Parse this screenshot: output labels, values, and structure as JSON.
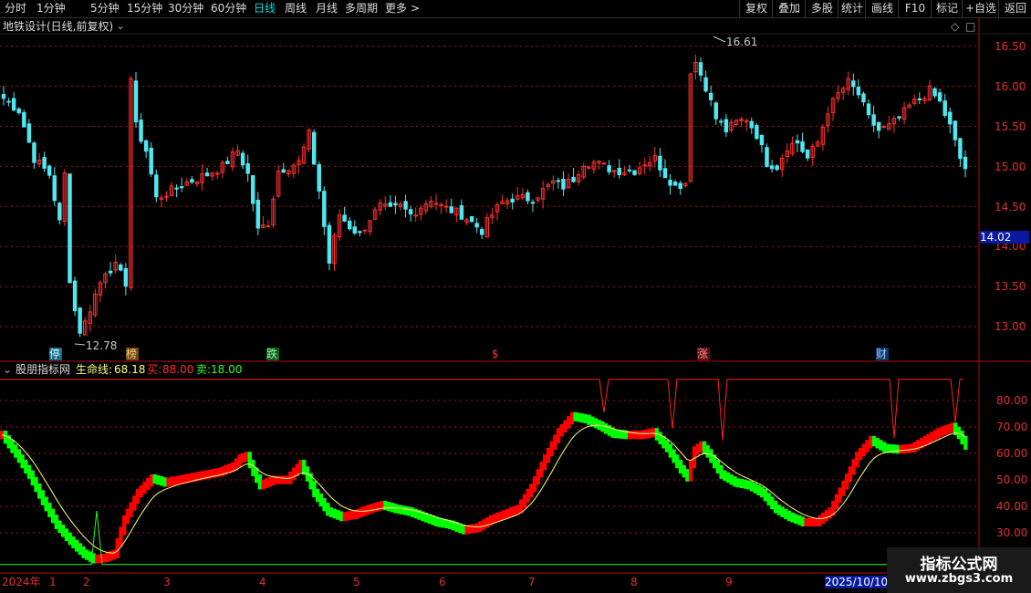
{
  "toolbar": {
    "periods": [
      "分时",
      "1分钟",
      "5分钟",
      "15分钟",
      "30分钟",
      "60分钟",
      "日线",
      "周线",
      "月线",
      "多周期",
      "更多"
    ],
    "selected_period": "日线",
    "right_buttons": [
      "复权",
      "叠加",
      "多股",
      "统计",
      "画线",
      "F10",
      "标记",
      "+自选",
      "返回"
    ]
  },
  "main_panel": {
    "title": "地铁设计(日线,前复权)",
    "price_ticks": [
      "16.50",
      "16.00",
      "15.50",
      "15.00",
      "14.50",
      "14.00",
      "13.50",
      "13.00"
    ],
    "current_price": "14.02",
    "high_label": "16.61",
    "low_label": "12.78",
    "event_markers": [
      "停",
      "榜",
      "跌",
      "$",
      "涨",
      "财"
    ]
  },
  "indicator_panel": {
    "name": "股朋指标网",
    "life_line_label": "生命线:",
    "life_line_value": "68.18",
    "buy_label": "买:",
    "buy_value": "88.00",
    "sell_label": "卖:",
    "sell_value": "18.00",
    "ticks": [
      "80.00",
      "70.00",
      "60.00",
      "50.00",
      "40.00",
      "30.00"
    ]
  },
  "time_axis": {
    "labels": [
      "2024年",
      "1",
      "2",
      "3",
      "4",
      "5",
      "6",
      "7",
      "8",
      "9",
      "2025/10/10/"
    ]
  },
  "watermark": {
    "line1": "指标公式网",
    "line2": "www.zbgs3.com"
  },
  "colors": {
    "up": "#ff3030",
    "down": "#50e8f0",
    "ind_up": "#ff0000",
    "ind_down": "#00ff00",
    "life_line": "#ffff80",
    "axis_red": "#b01010",
    "cyan_text": "#00e0e0"
  },
  "chart_data": {
    "type": "candlestick",
    "price_range": [
      12.6,
      16.8
    ],
    "indicator_range": [
      20,
      92
    ],
    "high": 16.61,
    "low": 12.78,
    "last_close": 14.02,
    "life_line_last": 68.18,
    "buy_level": 88.0,
    "sell_level": 18.0
  }
}
